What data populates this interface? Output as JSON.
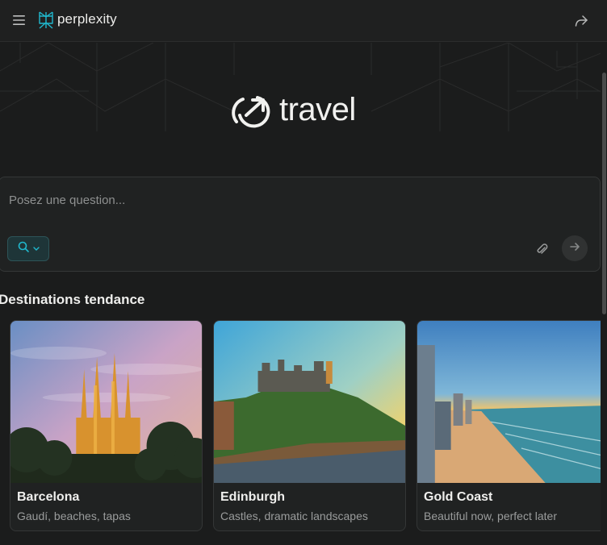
{
  "header": {
    "brand": "perplexity",
    "menu_icon": "hamburger-menu-icon",
    "share_icon": "share-arrow-icon"
  },
  "hero": {
    "title": "travel",
    "logo_icon": "travel-arrow-circle-icon"
  },
  "ask": {
    "placeholder": "Posez une question...",
    "value": "",
    "focus_icon": "search-icon",
    "attach_icon": "paperclip-icon",
    "submit_icon": "arrow-right-icon"
  },
  "trending": {
    "title": "Destinations tendance",
    "cards": [
      {
        "name": "Barcelona",
        "desc": "Gaudí, beaches, tapas"
      },
      {
        "name": "Edinburgh",
        "desc": "Castles, dramatic landscapes"
      },
      {
        "name": "Gold Coast",
        "desc": "Beautiful now, perfect later"
      }
    ]
  },
  "colors": {
    "background": "#1b1c1c",
    "accent_teal": "#20b8cd",
    "focus_bg": "#1e3538"
  }
}
